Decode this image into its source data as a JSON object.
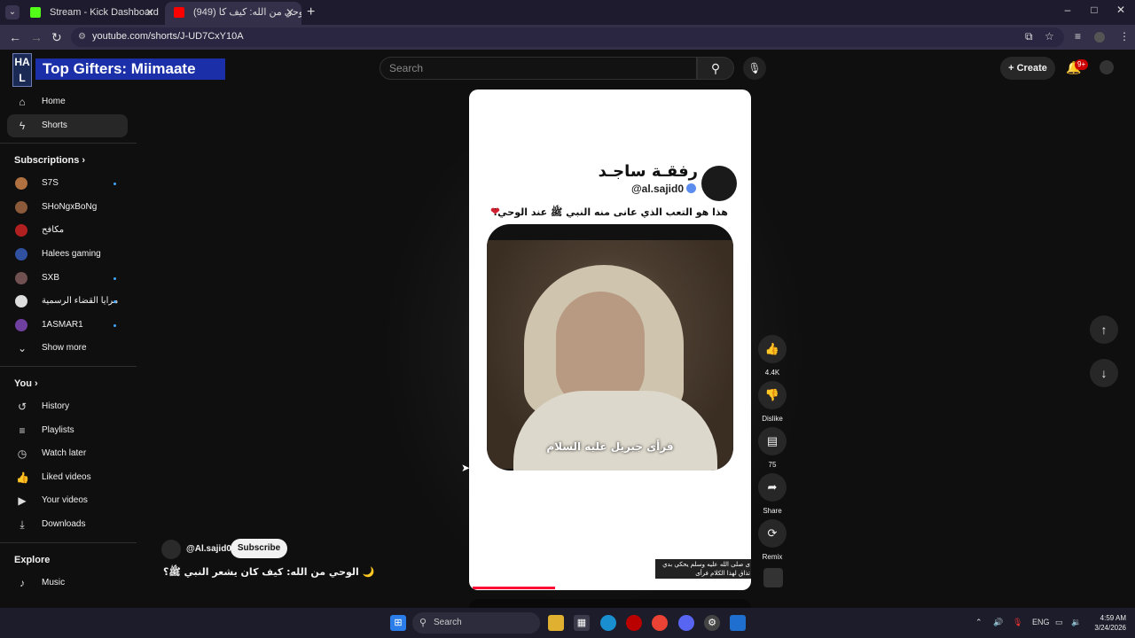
{
  "browser": {
    "tabs": [
      {
        "title": "Stream - Kick Dashboard",
        "active": false,
        "favicon_color": "#53fc18"
      },
      {
        "title": "(949) الوحي من الله: كيف كا",
        "active": true,
        "favicon_color": "#ff0000"
      }
    ],
    "url": "youtube.com/shorts/J-UD7CxY10A",
    "window_controls": [
      "–",
      "□",
      "✕"
    ]
  },
  "overlay": {
    "logo_text": "HA L",
    "top_gifters": "Top Gifters: Miimaate"
  },
  "header": {
    "search_placeholder": "Search",
    "create_label": "Create",
    "notif_badge": "9+"
  },
  "sidebar": {
    "main": [
      {
        "label": "Home",
        "icon": "home-icon",
        "glyph": "⌂"
      },
      {
        "label": "Shorts",
        "icon": "shorts-icon",
        "glyph": "ϟ",
        "active": true
      }
    ],
    "subscriptions_header": "Subscriptions",
    "subscriptions": [
      {
        "label": "S7S",
        "color": "#b07040",
        "live": true
      },
      {
        "label": "SHoNgxBoNg",
        "color": "#8a5a3a",
        "live": false
      },
      {
        "label": "مكافح",
        "color": "#b02020",
        "live": false
      },
      {
        "label": "Halees gaming",
        "color": "#3050a0",
        "live": false
      },
      {
        "label": "SXB",
        "color": "#705050",
        "live": true
      },
      {
        "label": "مرايا القضاء الرسمية",
        "color": "#dddddd",
        "live": true
      },
      {
        "label": "1ASMAR1",
        "color": "#7040a0",
        "live": true
      }
    ],
    "show_more": "Show more",
    "you_header": "You",
    "you_items": [
      {
        "label": "History",
        "glyph": "↺"
      },
      {
        "label": "Playlists",
        "glyph": "≡"
      },
      {
        "label": "Watch later",
        "glyph": "◷"
      },
      {
        "label": "Liked videos",
        "glyph": "👍"
      },
      {
        "label": "Your videos",
        "glyph": "▶"
      },
      {
        "label": "Downloads",
        "glyph": "⤓"
      }
    ],
    "explore_header": "Explore",
    "explore_items": [
      {
        "label": "Music",
        "glyph": "♪"
      }
    ]
  },
  "short": {
    "account_name": "رفقـة ساجـد",
    "handle": "@al.sajid0",
    "caption": "هذا هو التعب الذي عانى منه النبي ﷺ عند الوحي!",
    "subtitle": "فرأى جبريل عليه السلام",
    "overlay_text": "ى صلى الله عليه وسلم يحكي بدي\nتذاق لهذا الكلام فرأى",
    "progress_fraction": 0.3
  },
  "actions": [
    {
      "label": "4.4K",
      "glyph": "👍",
      "name": "like"
    },
    {
      "label": "Dislike",
      "glyph": "👎",
      "name": "dislike"
    },
    {
      "label": "75",
      "glyph": "▤",
      "name": "comments"
    },
    {
      "label": "Share",
      "glyph": "➦",
      "name": "share"
    },
    {
      "label": "Remix",
      "glyph": "⟳",
      "name": "remix"
    }
  ],
  "channel": {
    "name": "@Al.sajid0",
    "subscribe": "Subscribe",
    "title": "الوحي من الله: كيف كان يشعر النبي ﷺ؟ 🌙"
  },
  "taskbar": {
    "search": "Search",
    "lang": "ENG",
    "time": "4:59 AM",
    "date": "3/24/2026"
  }
}
